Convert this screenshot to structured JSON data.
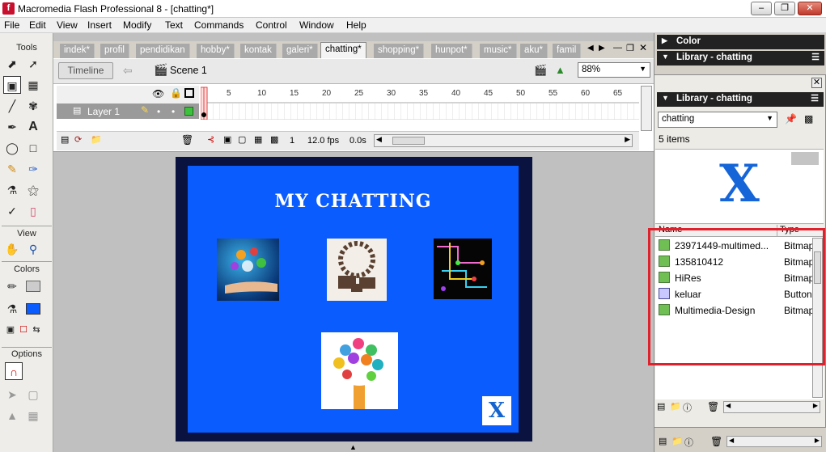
{
  "window": {
    "title": "Macromedia Flash Professional 8 - [chatting*]",
    "app_icon": "f"
  },
  "menu": [
    "File",
    "Edit",
    "View",
    "Insert",
    "Modify",
    "Text",
    "Commands",
    "Control",
    "Window",
    "Help"
  ],
  "tools": {
    "sections": [
      "Tools",
      "View",
      "Colors",
      "Options"
    ]
  },
  "tabs": [
    "indek*",
    "profil",
    "pendidikan",
    "hobby*",
    "kontak",
    "galeri*",
    "chatting*",
    "shopping*",
    "hunpot*",
    "music*",
    "aku*",
    "famil"
  ],
  "active_tab": "chatting*",
  "timeline": {
    "button": "Timeline",
    "scene": "Scene 1",
    "zoom": "88%",
    "layer_name": "Layer 1",
    "ruler": [
      "5",
      "10",
      "15",
      "20",
      "25",
      "30",
      "35",
      "40",
      "45",
      "50",
      "55",
      "60",
      "65"
    ],
    "current_frame": "1",
    "fps": "12.0 fps",
    "time": "0.0s"
  },
  "stage": {
    "title": "MY CHATTING",
    "close_button": "X"
  },
  "panels": {
    "color": "Color",
    "library_collapsed": "Library - chatting",
    "library": "Library - chatting",
    "doc_select": "chatting",
    "item_count": "5 items",
    "preview_glyph": "X",
    "col_name": "Name",
    "col_type": "Type"
  },
  "library_items": [
    {
      "name": "23971449-multimed...",
      "type": "Bitmap",
      "kind": "bitmap"
    },
    {
      "name": "135810412",
      "type": "Bitmap",
      "kind": "bitmap"
    },
    {
      "name": "HiRes",
      "type": "Bitmap",
      "kind": "bitmap"
    },
    {
      "name": "keluar",
      "type": "Button",
      "kind": "button"
    },
    {
      "name": "Multimedia-Design",
      "type": "Bitmap",
      "kind": "bitmap"
    }
  ],
  "colors": {
    "stage": "#0a5cff",
    "highlight": "#e0202a",
    "panel_header": "#222222"
  }
}
